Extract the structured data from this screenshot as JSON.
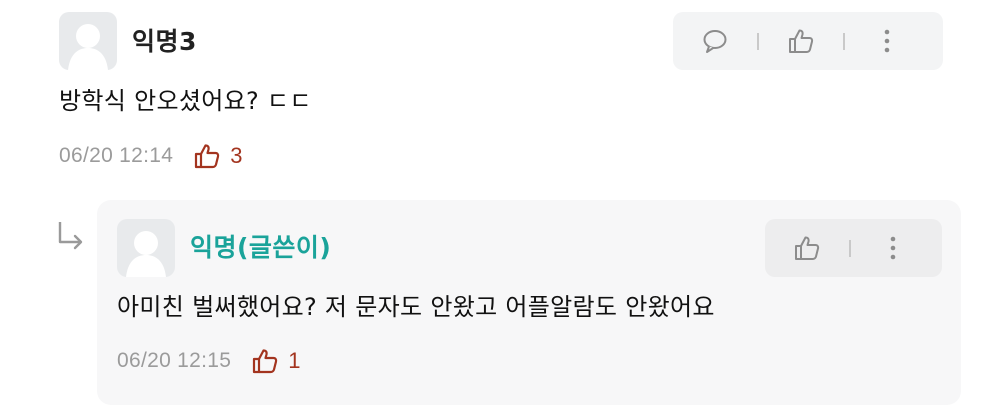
{
  "comment": {
    "author": "익명3",
    "text": "방학식 안오셨어요? ㄷㄷ",
    "date": "06/20 12:14",
    "likes": "3"
  },
  "reply": {
    "author": "익명(글쓴이)",
    "text": "아미친 벌써했어요? 저 문자도 안왔고 어플알람도 안왔어요",
    "date": "06/20 12:15",
    "likes": "1"
  },
  "colors": {
    "writer_accent": "#1aa39a",
    "like_red": "#a3341f",
    "meta_gray": "#9b9b9b"
  },
  "icons": {
    "comment_actions": [
      "speech-bubble-icon",
      "thumbs-up-icon",
      "more-vertical-icon"
    ],
    "reply_actions": [
      "thumbs-up-icon",
      "more-vertical-icon"
    ],
    "reply_indicator": "reply-arrow-icon"
  }
}
